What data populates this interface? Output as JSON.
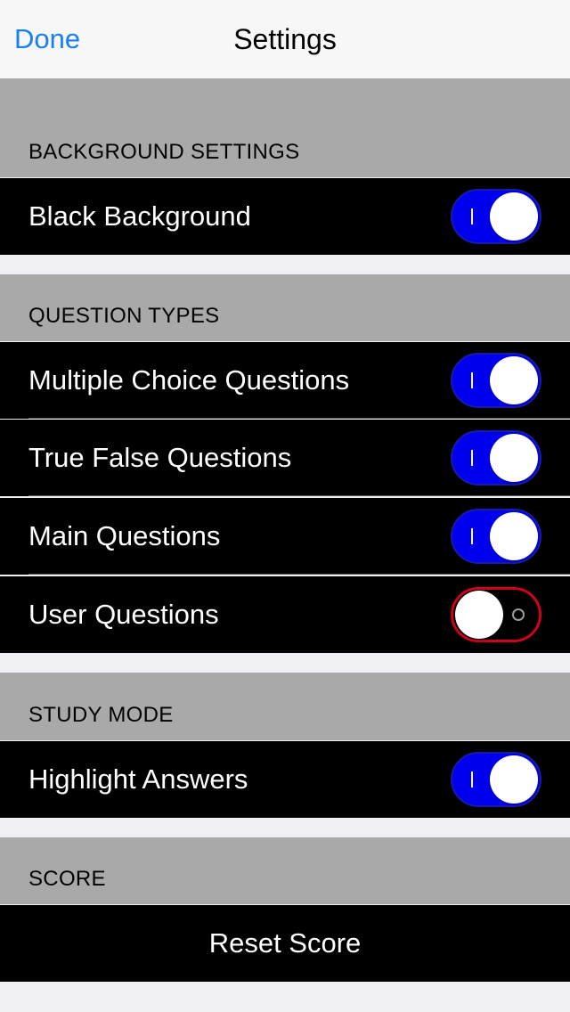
{
  "nav": {
    "done_label": "Done",
    "title": "Settings"
  },
  "colors": {
    "accent_blue": "#1a7ff0",
    "toggle_on": "#0000ee",
    "toggle_off_border": "#d0021b",
    "header_bg": "#a9a9a9",
    "cell_bg": "#000000"
  },
  "sections": [
    {
      "header": "BACKGROUND SETTINGS",
      "rows": [
        {
          "label": "Black Background",
          "on": true
        }
      ]
    },
    {
      "header": "QUESTION TYPES",
      "rows": [
        {
          "label": "Multiple Choice Questions",
          "on": true
        },
        {
          "label": "True False Questions",
          "on": true
        },
        {
          "label": "Main Questions",
          "on": true
        },
        {
          "label": "User Questions",
          "on": false
        }
      ]
    },
    {
      "header": "STUDY MODE",
      "rows": [
        {
          "label": "Highlight Answers",
          "on": true
        }
      ]
    },
    {
      "header": "SCORE",
      "button": "Reset Score"
    }
  ]
}
